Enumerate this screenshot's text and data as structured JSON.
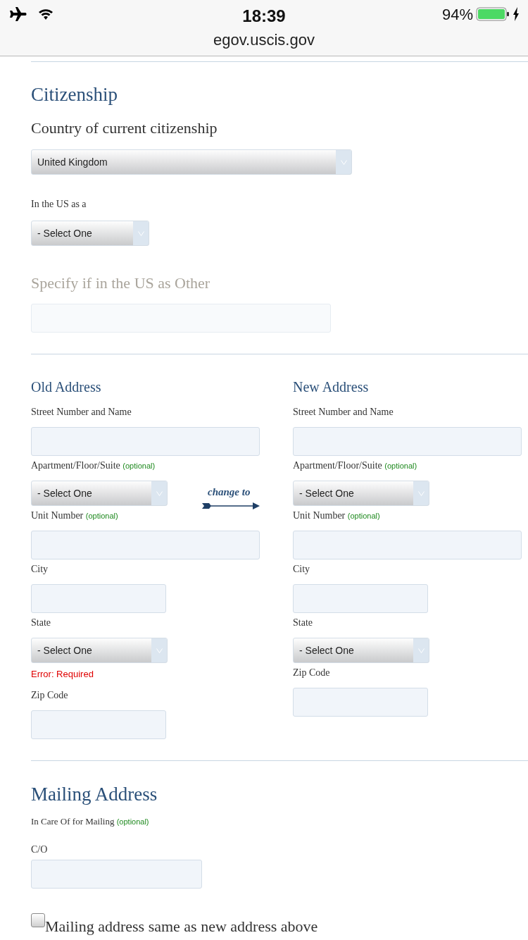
{
  "status_bar": {
    "time": "18:39",
    "battery": "94%",
    "url": "egov.uscis.gov"
  },
  "citizenship": {
    "heading": "Citizenship",
    "country": {
      "label": "Country of current citizenship",
      "value": "United Kingdom"
    },
    "status": {
      "label": "In the US as a",
      "value": "- Select One"
    },
    "other": {
      "label": "Specify if in the US as Other",
      "disabled": true
    }
  },
  "addresses": {
    "old": {
      "heading": "Old Address",
      "fields": [
        {
          "label": "Street Number and Name",
          "kind": "text"
        },
        {
          "label": "Apartment/Floor/Suite",
          "optional": "(optional)",
          "kind": "select",
          "value": "- Select One"
        },
        {
          "label": "Unit Number",
          "optional": "(optional)",
          "kind": "text"
        },
        {
          "label": "City",
          "kind": "short"
        },
        {
          "label": "State",
          "kind": "select",
          "value": "- Select One",
          "error": "Error: Required"
        },
        {
          "label": "Zip Code",
          "kind": "short"
        }
      ]
    },
    "connector": "change to",
    "new": {
      "heading": "New Address",
      "fields": [
        {
          "label": "Street Number and Name",
          "kind": "text"
        },
        {
          "label": "Apartment/Floor/Suite",
          "optional": "(optional)",
          "kind": "select",
          "value": "- Select One"
        },
        {
          "label": "Unit Number",
          "optional": "(optional)",
          "kind": "text"
        },
        {
          "label": "City",
          "kind": "short"
        },
        {
          "label": "State",
          "kind": "select",
          "value": "- Select One"
        },
        {
          "label": "Zip Code",
          "kind": "short"
        }
      ]
    }
  },
  "mailing": {
    "heading": "Mailing Address",
    "label": "In Care Of for Mailing",
    "optional": "(optional)",
    "sublabel": "C/O",
    "same_as_new": {
      "label": "Mailing address same as new address above",
      "checked": false
    }
  }
}
